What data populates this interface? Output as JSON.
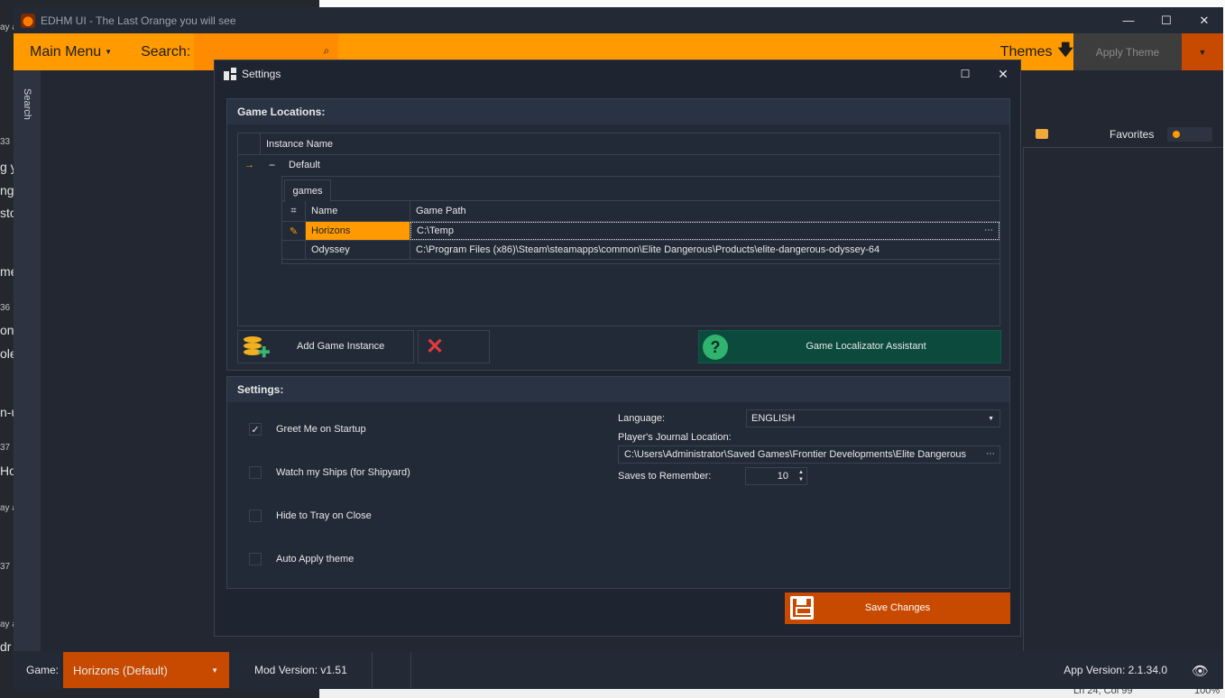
{
  "background": {
    "left_snippets": [
      "ay a",
      "33",
      "g y",
      "ng",
      "sto",
      "me",
      "36",
      "ons",
      "oler",
      "n-u",
      "37",
      "Ho",
      "ay a",
      "37",
      "ay a",
      "dr"
    ],
    "bottom_right_text": "Ln 24, Col 99",
    "bottom_right_zoom": "100%"
  },
  "window": {
    "title": "EDHM UI - The Last Orange you will see",
    "minimize": "—",
    "maximize": "☐",
    "close": "✕"
  },
  "toolbar": {
    "main_menu": "Main Menu",
    "search_label": "Search:",
    "search_value": "",
    "themes": "Themes",
    "apply_theme": "Apply Theme"
  },
  "side_rail": {
    "label": "Search"
  },
  "favorites": {
    "label": "Favorites"
  },
  "status_bar": {
    "game_label": "Game:",
    "game_value": "Horizons (Default)",
    "mod_version": "Mod Version: v1.51",
    "app_version": "App Version: 2.1.34.0"
  },
  "settings_dialog": {
    "title": "Settings",
    "game_locations": {
      "header": "Game Locations:",
      "grid_header": "Instance Name",
      "instance_row": "Default",
      "tab": "games",
      "columns": [
        "Name",
        "Game Path"
      ],
      "rows": [
        {
          "name": "Horizons",
          "path": "C:\\Temp"
        },
        {
          "name": "Odyssey",
          "path": "C:\\Program Files (x86)\\Steam\\steamapps\\common\\Elite Dangerous\\Products\\elite-dangerous-odyssey-64"
        }
      ],
      "add_button": "Add Game Instance",
      "assistant_button": "Game Localizator Assistant"
    },
    "settings": {
      "header": "Settings:",
      "checkboxes": [
        {
          "label": "Greet Me on Startup",
          "checked": true
        },
        {
          "label": "Watch my Ships (for Shipyard)",
          "checked": false
        },
        {
          "label": "Hide to Tray on Close",
          "checked": false
        },
        {
          "label": "Auto Apply theme",
          "checked": false
        }
      ],
      "language_label": "Language:",
      "language_value": "ENGLISH",
      "journal_label": "Player's Journal Location:",
      "journal_value": "C:\\Users\\Administrator\\Saved Games\\Frontier Developments\\Elite Dangerous",
      "saves_label": "Saves to Remember:",
      "saves_value": "10"
    },
    "save_button": "Save Changes"
  },
  "colors": {
    "accent_orange": "#ff9a00",
    "accent_dark_orange": "#c74a00",
    "window_bg": "#222731",
    "assistant_green": "#0b4a3d"
  }
}
